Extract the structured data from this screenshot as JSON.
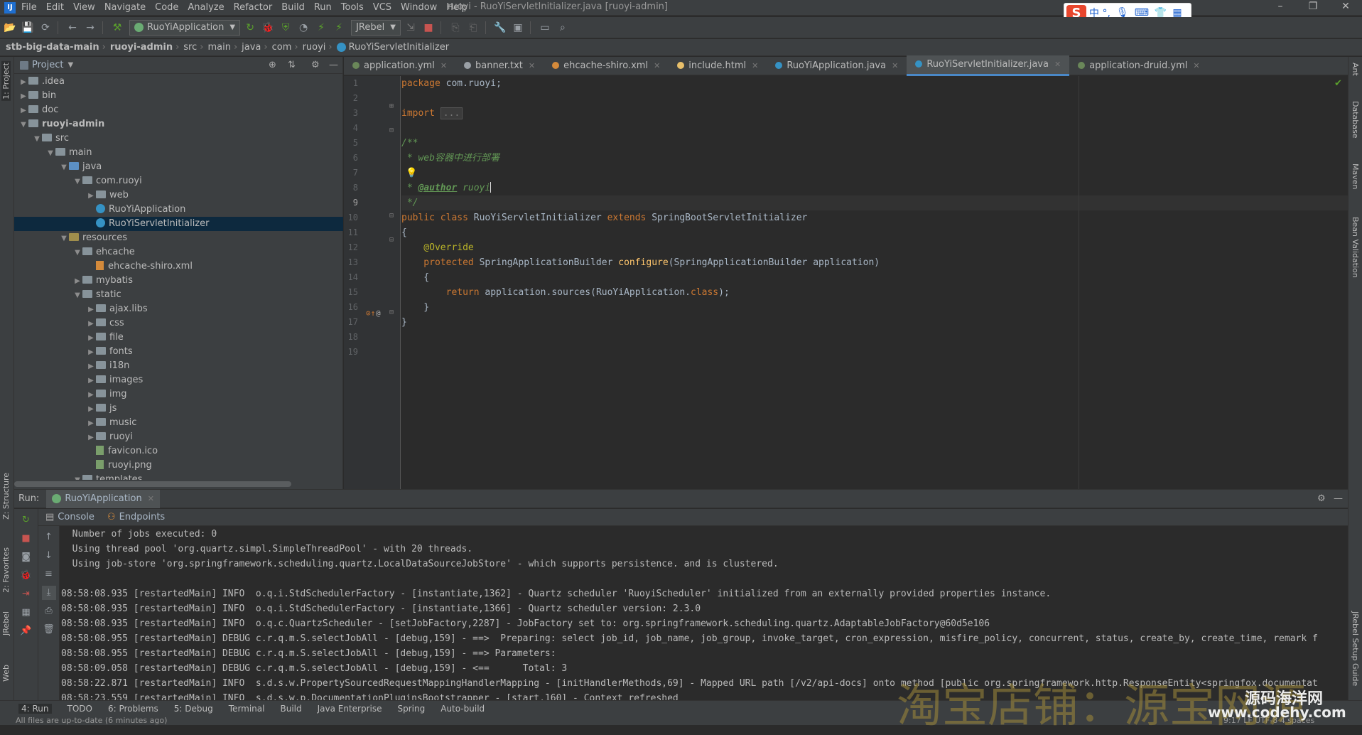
{
  "menu": {
    "items": [
      "File",
      "Edit",
      "View",
      "Navigate",
      "Code",
      "Analyze",
      "Refactor",
      "Build",
      "Run",
      "Tools",
      "VCS",
      "Window",
      "Help"
    ],
    "window_title": "ruoyi - RuoYiServletInitializer.java [ruoyi-admin]"
  },
  "toolbar": {
    "run_config": "RuoYiApplication",
    "jrebel": "JRebel"
  },
  "breadcrumb": [
    "stb-big-data-main",
    "ruoyi-admin",
    "src",
    "main",
    "java",
    "com",
    "ruoyi",
    "RuoYiServletInitializer"
  ],
  "left_strip": {
    "project": "1: Project",
    "structure": "Z: Structure",
    "favorites": "2: Favorites",
    "jrebel": "JRebel",
    "web": "Web"
  },
  "right_strip": {
    "ant": "Ant",
    "database": "Database",
    "maven": "Maven",
    "bean": "Bean Validation",
    "jrebel_setup": "JRebel Setup Guide"
  },
  "project": {
    "title": "Project",
    "tree": [
      {
        "label": ".idea",
        "depth": 1,
        "type": "folder",
        "expanded": false
      },
      {
        "label": "bin",
        "depth": 1,
        "type": "folder",
        "expanded": false
      },
      {
        "label": "doc",
        "depth": 1,
        "type": "folder",
        "expanded": false
      },
      {
        "label": "ruoyi-admin",
        "depth": 1,
        "type": "module",
        "expanded": true
      },
      {
        "label": "src",
        "depth": 2,
        "type": "folder",
        "expanded": true
      },
      {
        "label": "main",
        "depth": 3,
        "type": "folder",
        "expanded": true
      },
      {
        "label": "java",
        "depth": 4,
        "type": "src",
        "expanded": true
      },
      {
        "label": "com.ruoyi",
        "depth": 5,
        "type": "pkg",
        "expanded": true
      },
      {
        "label": "web",
        "depth": 6,
        "type": "pkg",
        "expanded": false
      },
      {
        "label": "RuoYiApplication",
        "depth": 6,
        "type": "class",
        "expanded": null
      },
      {
        "label": "RuoYiServletInitializer",
        "depth": 6,
        "type": "class",
        "expanded": null,
        "selected": true
      },
      {
        "label": "resources",
        "depth": 4,
        "type": "res",
        "expanded": true
      },
      {
        "label": "ehcache",
        "depth": 5,
        "type": "folder",
        "expanded": true
      },
      {
        "label": "ehcache-shiro.xml",
        "depth": 6,
        "type": "xml",
        "expanded": null
      },
      {
        "label": "mybatis",
        "depth": 5,
        "type": "folder",
        "expanded": false
      },
      {
        "label": "static",
        "depth": 5,
        "type": "folder",
        "expanded": true
      },
      {
        "label": "ajax.libs",
        "depth": 6,
        "type": "folder",
        "expanded": false
      },
      {
        "label": "css",
        "depth": 6,
        "type": "folder",
        "expanded": false
      },
      {
        "label": "file",
        "depth": 6,
        "type": "folder",
        "expanded": false
      },
      {
        "label": "fonts",
        "depth": 6,
        "type": "folder",
        "expanded": false
      },
      {
        "label": "i18n",
        "depth": 6,
        "type": "folder",
        "expanded": false
      },
      {
        "label": "images",
        "depth": 6,
        "type": "folder",
        "expanded": false
      },
      {
        "label": "img",
        "depth": 6,
        "type": "folder",
        "expanded": false
      },
      {
        "label": "js",
        "depth": 6,
        "type": "folder",
        "expanded": false
      },
      {
        "label": "music",
        "depth": 6,
        "type": "folder",
        "expanded": false
      },
      {
        "label": "ruoyi",
        "depth": 6,
        "type": "folder",
        "expanded": false
      },
      {
        "label": "favicon.ico",
        "depth": 6,
        "type": "img",
        "expanded": null
      },
      {
        "label": "ruoyi.png",
        "depth": 6,
        "type": "img",
        "expanded": null
      },
      {
        "label": "templates",
        "depth": 5,
        "type": "folder",
        "expanded": true
      }
    ]
  },
  "editor": {
    "tabs": [
      {
        "label": "application.yml",
        "color": "#6a8759"
      },
      {
        "label": "banner.txt",
        "color": "#9aa0a6"
      },
      {
        "label": "ehcache-shiro.xml",
        "color": "#d48a3b"
      },
      {
        "label": "include.html",
        "color": "#e8bf6a"
      },
      {
        "label": "RuoYiApplication.java",
        "color": "#3592c4"
      },
      {
        "label": "RuoYiServletInitializer.java",
        "color": "#3592c4",
        "active": true
      },
      {
        "label": "application-druid.yml",
        "color": "#6a8759"
      }
    ],
    "line_numbers": [
      "1",
      "2",
      "3",
      "4",
      "5",
      "6",
      "7",
      "8",
      "9",
      "10",
      "11",
      "12",
      "13",
      "14",
      "15",
      "16",
      "17",
      "18",
      "19"
    ],
    "code": {
      "l1_kw": "package",
      "l1_rest": " com.ruoyi;",
      "l3_kw": "import",
      "l3_fold": "...",
      "l6": "/**",
      "l7": " * web容器中进行部署",
      "l9_star": " * ",
      "l9_tag": "@author",
      "l9_name": " ruoyi",
      "l10": " */",
      "l11_kw1": "public class",
      "l11_name": " RuoYiServletInitializer ",
      "l11_kw2": "extends",
      "l11_base": " SpringBootServletInitializer",
      "l12": "{",
      "l13": "    @Override",
      "l14_kw": "    protected",
      "l14_type": " SpringApplicationBuilder ",
      "l14_fn": "configure",
      "l14_rest": "(SpringApplicationBuilder application)",
      "l15": "    {",
      "l16_kw": "        return",
      "l16_mid": " application.sources(RuoYiApplication.",
      "l16_kw2": "class",
      "l16_end": ");",
      "l17": "    }",
      "l18": "}"
    }
  },
  "run": {
    "label": "Run:",
    "config_tab": "RuoYiApplication",
    "console_tab": "Console",
    "endpoints_tab": "Endpoints",
    "log": [
      "  Number of jobs executed: 0",
      "  Using thread pool 'org.quartz.simpl.SimpleThreadPool' - with 20 threads.",
      "  Using job-store 'org.springframework.scheduling.quartz.LocalDataSourceJobStore' - which supports persistence. and is clustered.",
      "",
      "08:58:08.935 [restartedMain] INFO  o.q.i.StdSchedulerFactory - [instantiate,1362] - Quartz scheduler 'RuoyiScheduler' initialized from an externally provided properties instance.",
      "08:58:08.935 [restartedMain] INFO  o.q.i.StdSchedulerFactory - [instantiate,1366] - Quartz scheduler version: 2.3.0",
      "08:58:08.935 [restartedMain] INFO  o.q.c.QuartzScheduler - [setJobFactory,2287] - JobFactory set to: org.springframework.scheduling.quartz.AdaptableJobFactory@60d5e106",
      "08:58:08.955 [restartedMain] DEBUG c.r.q.m.S.selectJobAll - [debug,159] - ==>  Preparing: select job_id, job_name, job_group, invoke_target, cron_expression, misfire_policy, concurrent, status, create_by, create_time, remark f",
      "08:58:08.955 [restartedMain] DEBUG c.r.q.m.S.selectJobAll - [debug,159] - ==> Parameters: ",
      "08:58:09.058 [restartedMain] DEBUG c.r.q.m.S.selectJobAll - [debug,159] - <==      Total: 3",
      "08:58:22.871 [restartedMain] INFO  s.d.s.w.PropertySourcedRequestMappingHandlerMapping - [initHandlerMethods,69] - Mapped URL path [/v2/api-docs] onto method [public org.springframework.http.ResponseEntity<springfox.documentat",
      "08:58:23.559 [restartedMain] INFO  s.d.s.w.p.DocumentationPluginsBootstrapper - [start,160] - Context refreshed"
    ]
  },
  "bottom_tabs": [
    "4: Run",
    "TODO",
    "6: Problems",
    "5: Debug",
    "Terminal",
    "Build",
    "Java Enterprise",
    "Spring",
    "Auto-build"
  ],
  "status": {
    "left": "All files are up-to-date (6 minutes ago)",
    "right": "9:17  LF  UTF-8  4 spaces"
  },
  "watermark": {
    "main": "淘宝店铺：源宝网源",
    "site_cn": "源码海洋网",
    "site_url": "www.codehy.com"
  },
  "ime": {
    "text": "中 °,"
  }
}
